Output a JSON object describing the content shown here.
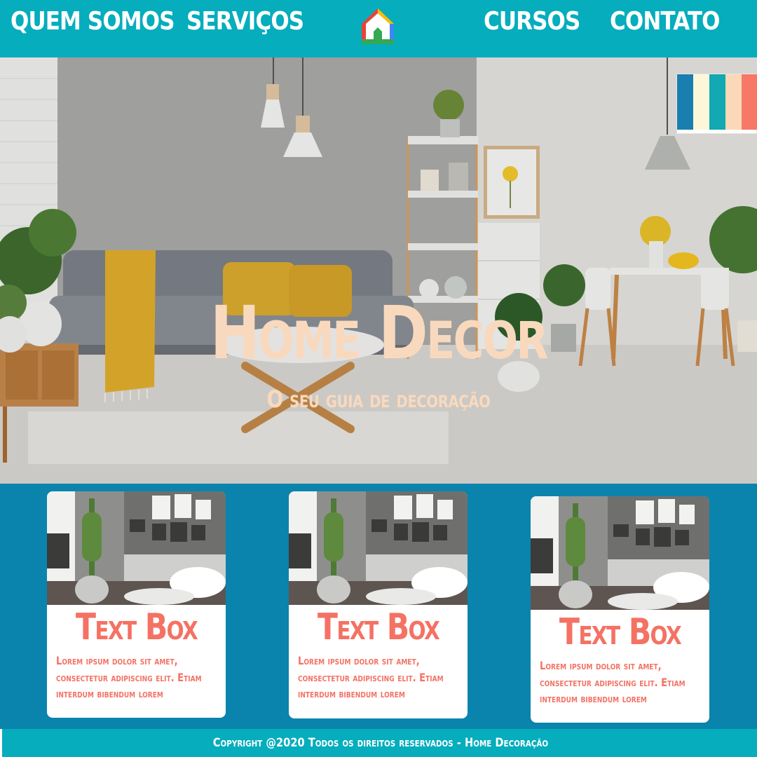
{
  "nav": {
    "items": [
      {
        "label": "QUEM SOMOS"
      },
      {
        "label": "SERVIÇOS"
      },
      {
        "label": "CURSOS"
      },
      {
        "label": "CONTATO"
      }
    ],
    "logo_icon": "house-icon",
    "logo_colors": [
      "#ea4335",
      "#fbbc04",
      "#34a853",
      "#4285f4"
    ]
  },
  "hero": {
    "title": "Home Decor",
    "subtitle": "O seu guia de decoração",
    "palette_colors": [
      "#1a7fb0",
      "#fdf7d9",
      "#12a9b3",
      "#fbd9b8",
      "#f77866"
    ]
  },
  "cards": [
    {
      "title": "Text Box",
      "text": "Lorem ipsum dolor sit amet, consectetur adipiscing elit. Etiam interdum bibendum lorem"
    },
    {
      "title": "Text Box",
      "text": "Lorem ipsum dolor sit amet, consectetur adipiscing elit. Etiam interdum bibendum lorem"
    },
    {
      "title": "Text Box",
      "text": "Lorem ipsum dolor sit amet, consectetur adipiscing elit. Etiam interdum bibendum lorem"
    }
  ],
  "footer": {
    "text": "Copyright @2020 Todos os direitos reservados - Home Decoração"
  },
  "colors": {
    "nav_bg": "#05adbd",
    "section_bg": "#0a84ac",
    "title_color": "#f9d9bd",
    "card_accent": "#f47264"
  }
}
